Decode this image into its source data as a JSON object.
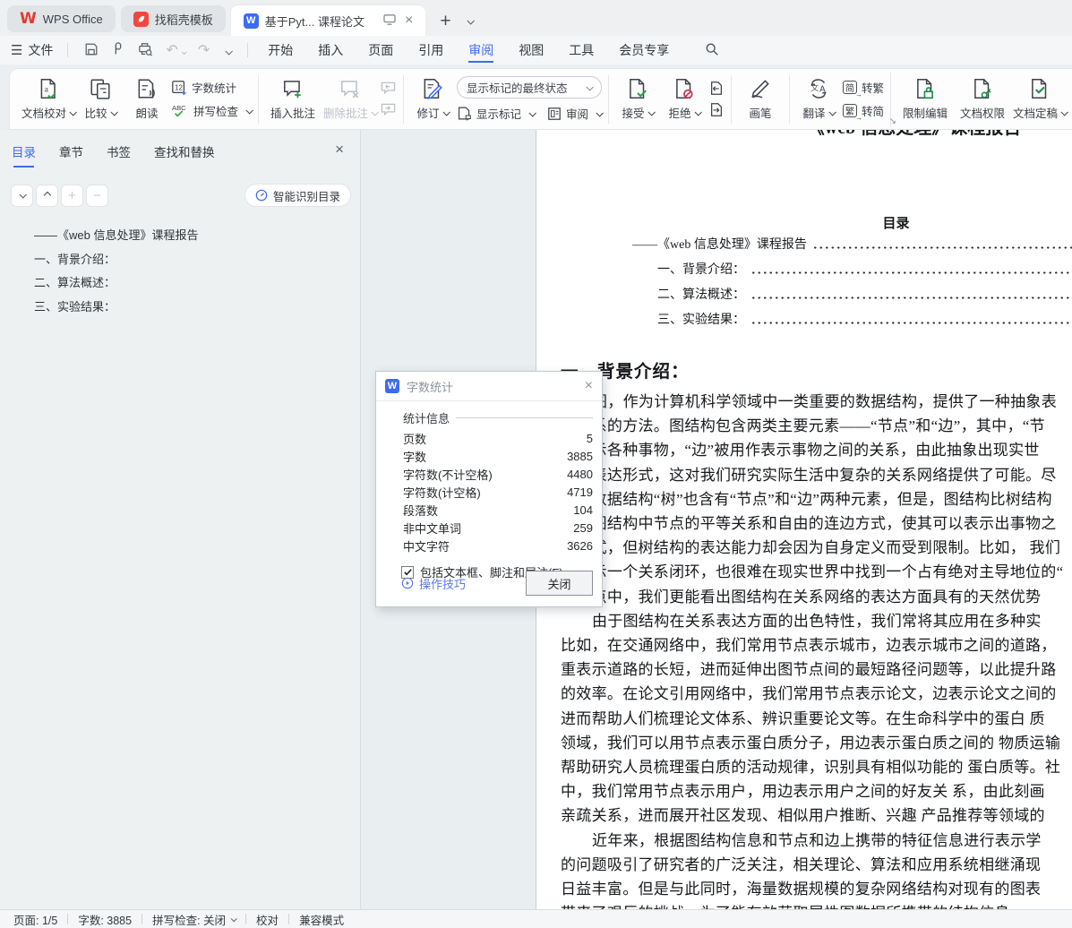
{
  "tabbar": {
    "tabs": [
      {
        "label": "WPS Office"
      },
      {
        "label": "找稻壳模板"
      },
      {
        "label": "基于Pyt... 课程论文"
      }
    ]
  },
  "menubar": {
    "file": "文件",
    "menus": [
      "开始",
      "插入",
      "页面",
      "引用",
      "审阅",
      "视图",
      "工具",
      "会员专享"
    ]
  },
  "ribbon": {
    "word_count": "字数统计",
    "proofread": "文档校对",
    "compare": "比较",
    "read_aloud": "朗读",
    "spell_check": "拼写检查",
    "insert_comment": "插入批注",
    "delete_comment": "删除批注",
    "track_changes": "修订",
    "markup_state": "显示标记的最终状态",
    "show_markup": "显示标记",
    "review_pane": "审阅",
    "accept": "接受",
    "reject": "拒绝",
    "pen": "画笔",
    "translate": "翻译",
    "simp_char": "简",
    "trad_char": "繁",
    "to_traditional": "转繁",
    "to_simplified": "转简",
    "restrict_edit": "限制编辑",
    "doc_permission": "文档权限",
    "doc_final": "文档定稿"
  },
  "sidebar": {
    "tabs": [
      "目录",
      "章节",
      "书签",
      "查找和替换"
    ],
    "smart_toc": "智能识别目录",
    "toc": [
      "——《web 信息处理》课程报告",
      "一、背景介绍：",
      "二、算法概述：",
      "三、实验结果："
    ]
  },
  "document": {
    "clipped_title": "——《web 信息处理》课程报告",
    "toc_heading": "目录",
    "toc_entries": [
      "——《web 信息处理》课程报告",
      "一、背景介绍：",
      "二、算法概述：",
      "三、实验结果："
    ],
    "section_heading": "一、背景介绍：",
    "lines": [
      "图，作为计算机科学领域中一类重要的数据结构，提供了一种抽象表",
      "间关系的方法。图结构包含两类主要元素——“节点”和“边”，其中，“节",
      "作表示各种事物，“边”被用作表示事物之间的关系，由此抽象出现实世",
      "系的表达形式，这对我们研究实际生活中复杂的关系网络提供了可能。尽",
      "要的数据结构“树”也含有“节点”和“边”两种元素，但是，图结构比树结构",
      "性。图结构中节点的平等关系和自由的连边方式，使其可以表示出事物之",
      "系形式，但树结构的表达能力却会因为自身定义而受到限制。比如， 我们",
      "构表示一个关系闭环，也很难在现实世界中找到一个占有绝对主导地位的“",
      "这一点中，我们更能看出图结构在关系网络的表达方面具有的天然优势",
      "由于图结构在关系表达方面的出色特性，我们常将其应用在多种实",
      "比如，在交通网络中，我们常用节点表示城市，边表示城市之间的道路，",
      "重表示道路的长短，进而延伸出图节点间的最短路径问题等，以此提升路",
      "的效率。在论文引用网络中，我们常用节点表示论文，边表示论文之间的",
      "进而帮助人们梳理论文体系、辨识重要论文等。在生命科学中的蛋白 质",
      "领域，我们可以用节点表示蛋白质分子，用边表示蛋白质之间的 物质运输",
      "帮助研究人员梳理蛋白质的活动规律，识别具有相似功能的 蛋白质等。社",
      "中，我们常用节点表示用户，用边表示用户之间的好友关 系，由此刻画",
      "亲疏关系，进而展开社区发现、相似用户推断、兴趣 产品推荐等领域的",
      "近年来，根据图结构信息和节点和边上携带的特征信息进行表示学",
      "的问题吸引了研究者的广泛关注，相关理论、算法和应用系统相继涌现",
      "日益丰富。但是与此同时，海量数据规模的复杂网络结构对现有的图表",
      "带来了艰巨的挑战，为了能有效获取属性图数据所携带的结构信息"
    ]
  },
  "dialog": {
    "title": "字数统计",
    "section": "统计信息",
    "rows": [
      {
        "label": "页数",
        "value": "5"
      },
      {
        "label": "字数",
        "value": "3885"
      },
      {
        "label": "字符数(不计空格)",
        "value": "4480"
      },
      {
        "label": "字符数(计空格)",
        "value": "4719"
      },
      {
        "label": "段落数",
        "value": "104"
      },
      {
        "label": "非中文单词",
        "value": "259"
      },
      {
        "label": "中文字符",
        "value": "3626"
      }
    ],
    "checkbox_label": "包括文本框、脚注和尾注(F)",
    "tips_link": "操作技巧",
    "close_button": "关闭"
  },
  "statusbar": {
    "page": "页面: 1/5",
    "words": "字数: 3885",
    "spell": "拼写检查: 关闭",
    "proof": "校对",
    "compat": "兼容模式"
  },
  "icons": {
    "close": "×",
    "plus": "+",
    "wps_w": "W",
    "doc_w": "W",
    "hamburger": "☰",
    "undo": "↶",
    "redo": "↷",
    "expand": "↘"
  }
}
